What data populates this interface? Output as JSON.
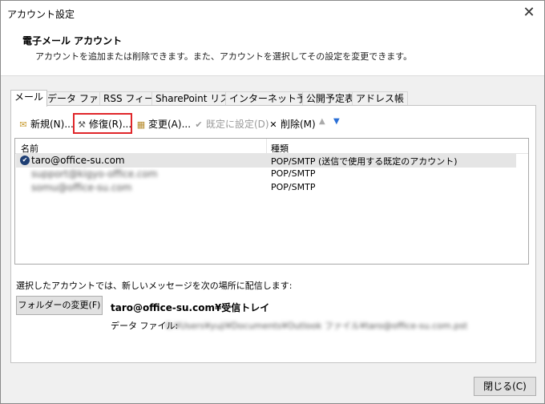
{
  "window": {
    "title": "アカウント設定",
    "close_glyph": "✕"
  },
  "header": {
    "title": "電子メール アカウント",
    "description": "アカウントを追加または削除できます。また、アカウントを選択してその設定を変更できます。"
  },
  "tabs": [
    {
      "label": "メール",
      "active": true
    },
    {
      "label": "データ ファイル"
    },
    {
      "label": "RSS フィード"
    },
    {
      "label": "SharePoint リスト"
    },
    {
      "label": "インターネット予定表"
    },
    {
      "label": "公開予定表"
    },
    {
      "label": "アドレス帳"
    }
  ],
  "toolbar": {
    "new_label": "新規(N)...",
    "repair_label": "修復(R)...",
    "change_label": "変更(A)...",
    "default_label": "既定に設定(D)",
    "delete_label": "削除(M)",
    "icons": {
      "new": "new-mail-icon",
      "repair": "repair-tools-icon",
      "change": "change-icon",
      "default": "check-circle-icon",
      "delete": "x-delete-icon",
      "up": "arrow-up-icon",
      "down": "arrow-down-icon"
    }
  },
  "list": {
    "columns": {
      "name": "名前",
      "type": "種類"
    },
    "rows": [
      {
        "name": "taro@office-su.com",
        "type": "POP/SMTP (送信で使用する既定のアカウント)",
        "default": true
      },
      {
        "name": "support@kigyo-office.com",
        "type": "POP/SMTP"
      },
      {
        "name": "somu@office-su.com",
        "type": "POP/SMTP"
      }
    ]
  },
  "delivery": {
    "label": "選択したアカウントでは、新しいメッセージを次の場所に配信します:",
    "folder_button": "フォルダーの変更(F)",
    "inbox_path": "taro@office-su.com¥受信トレイ",
    "datafile_label": "データ ファイル:",
    "datafile_path": "C:¥Users¥yuji¥Documents¥Outlook ファイル¥taro@office-su.com.pst"
  },
  "footer": {
    "close_label": "閉じる(C)"
  },
  "colors": {
    "highlight": "#e0262a",
    "check": "#1f3f74",
    "arrow_down": "#2a6fd6"
  }
}
